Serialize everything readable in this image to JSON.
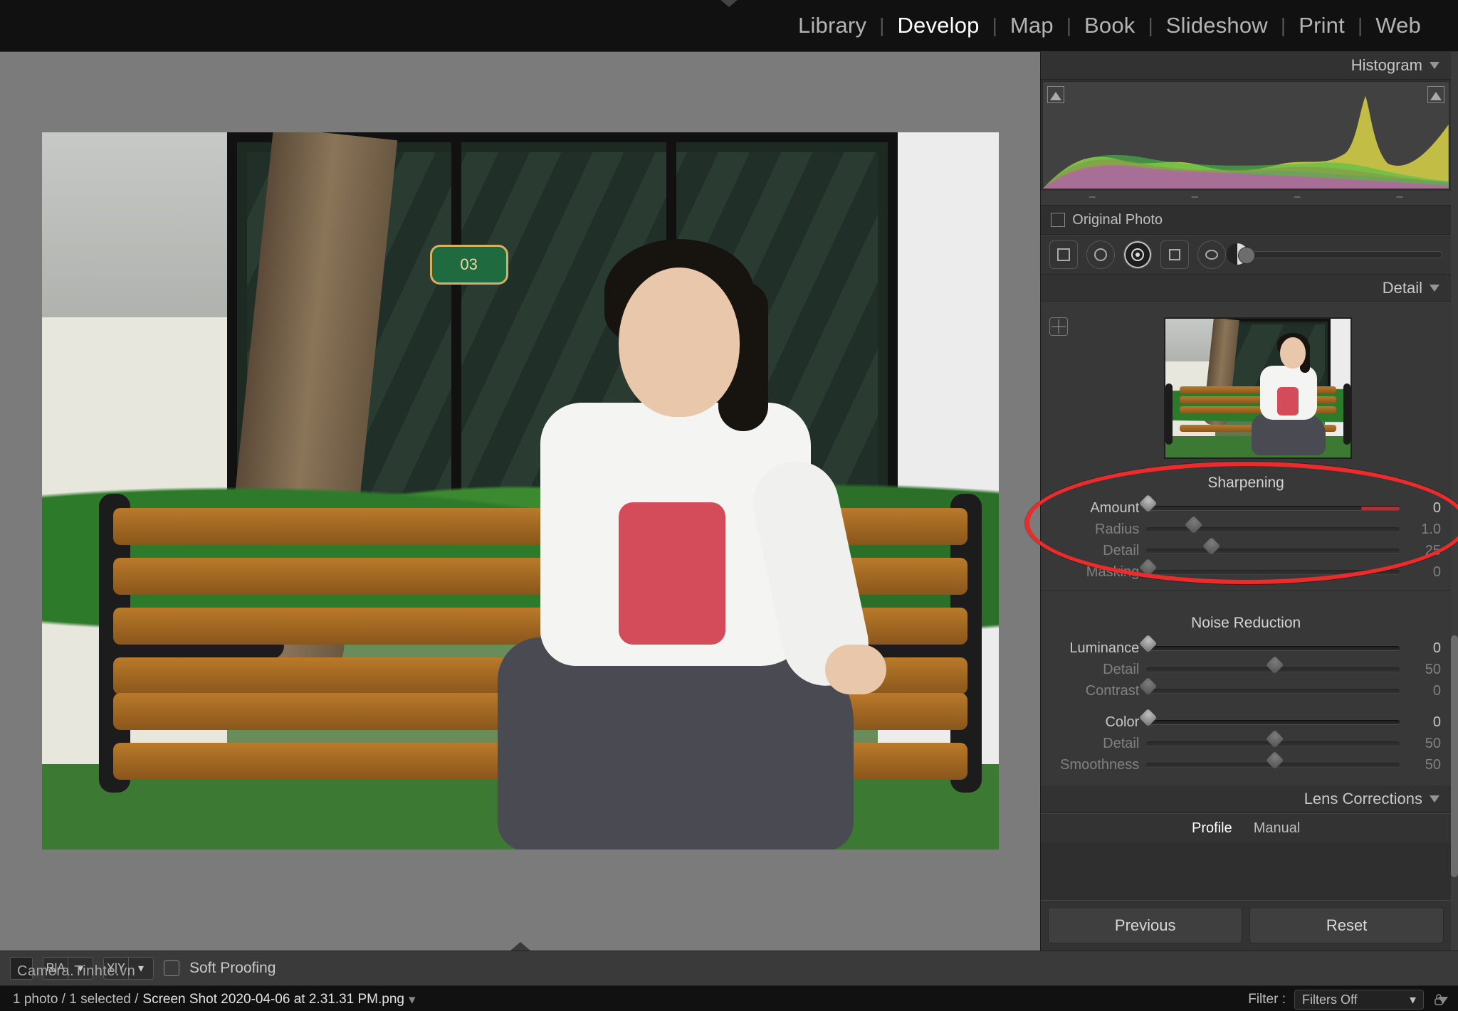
{
  "nav": {
    "items": [
      {
        "label": "Library",
        "active": false
      },
      {
        "label": "Develop",
        "active": true
      },
      {
        "label": "Map",
        "active": false
      },
      {
        "label": "Book",
        "active": false
      },
      {
        "label": "Slideshow",
        "active": false
      },
      {
        "label": "Print",
        "active": false
      },
      {
        "label": "Web",
        "active": false
      }
    ]
  },
  "histogram_panel_title": "Histogram",
  "original_photo_label": "Original Photo",
  "detail_panel": {
    "title": "Detail",
    "sharpening_title": "Sharpening",
    "noise_title": "Noise Reduction",
    "sliders": {
      "amount": {
        "label": "Amount",
        "value": "0",
        "pos": 0
      },
      "radius": {
        "label": "Radius",
        "value": "1.0",
        "pos": 18
      },
      "detail": {
        "label": "Detail",
        "value": "25",
        "pos": 25
      },
      "masking": {
        "label": "Masking",
        "value": "0",
        "pos": 0
      },
      "luminance": {
        "label": "Luminance",
        "value": "0",
        "pos": 0
      },
      "ldetail": {
        "label": "Detail",
        "value": "50",
        "pos": 50
      },
      "lcontrast": {
        "label": "Contrast",
        "value": "0",
        "pos": 0
      },
      "color": {
        "label": "Color",
        "value": "0",
        "pos": 0
      },
      "cdetail": {
        "label": "Detail",
        "value": "50",
        "pos": 50
      },
      "smooth": {
        "label": "Smoothness",
        "value": "50",
        "pos": 50
      }
    }
  },
  "lens_panel": {
    "title": "Lens Corrections",
    "tabs": {
      "profile": "Profile",
      "manual": "Manual"
    }
  },
  "buttons": {
    "previous": "Previous",
    "reset": "Reset"
  },
  "toolbar": {
    "soft_proofing": "Soft Proofing"
  },
  "sign_text": "03",
  "watermark": "Camera.Tinhte.vn",
  "status": {
    "counts": "1 photo / 1 selected /",
    "filename": "Screen Shot 2020-04-06 at 2.31.31 PM.png",
    "filter_label": "Filter :",
    "filter_value": "Filters Off"
  }
}
